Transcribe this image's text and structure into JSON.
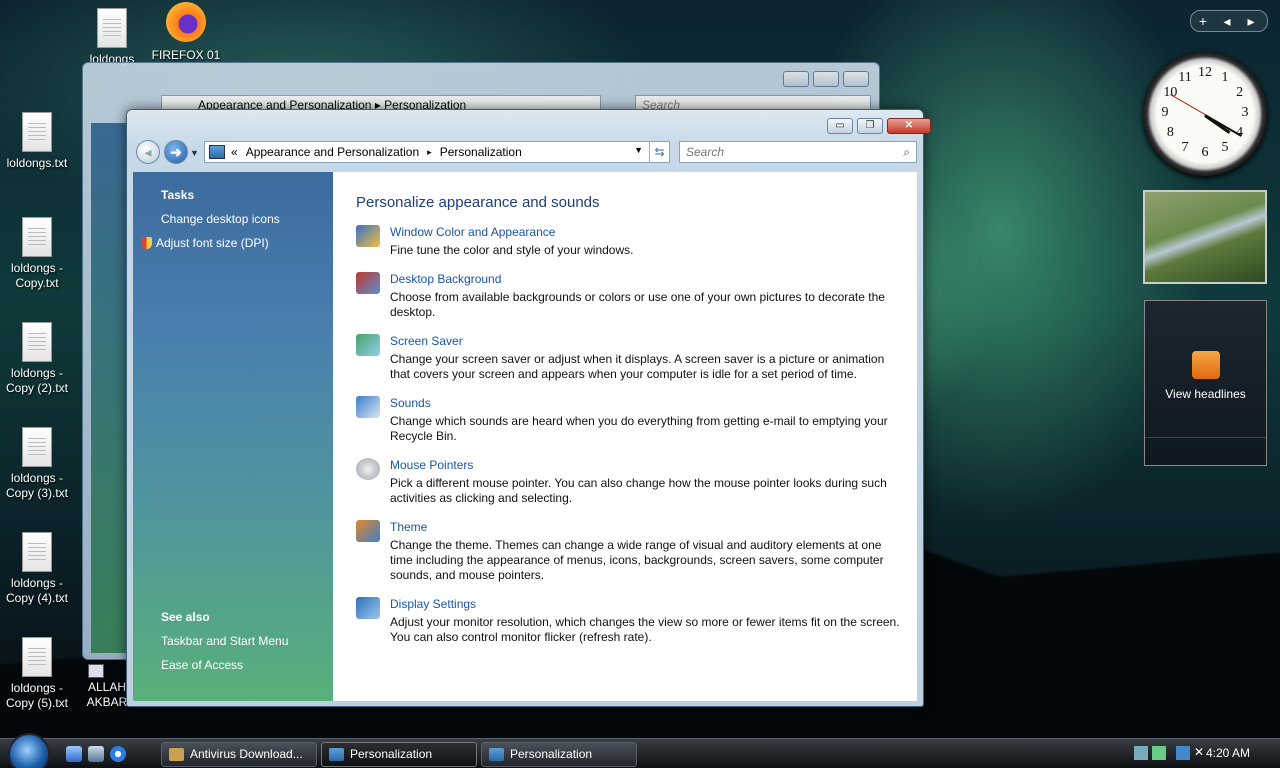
{
  "desktop": {
    "icons": [
      {
        "label": "loldongs.txt",
        "kind": "file"
      },
      {
        "label": "loldongs - Copy.txt",
        "kind": "file"
      },
      {
        "label": "loldongs - Copy (2).txt",
        "kind": "file"
      },
      {
        "label": "loldongs - Copy (3).txt",
        "kind": "file"
      },
      {
        "label": "loldongs - Copy (4).txt",
        "kind": "file"
      },
      {
        "label": "loldongs - Copy (5).txt",
        "kind": "file"
      },
      {
        "label": "loldongs",
        "kind": "file"
      },
      {
        "label": "FIREFOX 01",
        "kind": "firefox-shortcut"
      },
      {
        "label": "ALLAH AKBAR",
        "kind": "shortcut"
      }
    ]
  },
  "back_window": {
    "breadcrumb": [
      "Appearance and Personalization",
      "Personalization"
    ],
    "search_placeholder": "Search"
  },
  "window": {
    "controls": {
      "minimize": "▭",
      "maximize": "❐",
      "close": "✕"
    },
    "breadcrumb_prefix": "«",
    "breadcrumb": [
      "Appearance and Personalization",
      "Personalization"
    ],
    "breadcrumb_sep": "▸",
    "search_placeholder": "Search",
    "sidebar": {
      "tasks_heading": "Tasks",
      "tasks": [
        "Change desktop icons",
        "Adjust font size (DPI)"
      ],
      "see_also_heading": "See also",
      "see_also": [
        "Taskbar and Start Menu",
        "Ease of Access"
      ]
    },
    "main": {
      "heading": "Personalize appearance and sounds",
      "items": [
        {
          "title": "Window Color and Appearance",
          "desc": "Fine tune the color and style of your windows.",
          "icon": "window-color-icon",
          "color": "#3a6fc4"
        },
        {
          "title": "Desktop Background",
          "desc": "Choose from available backgrounds or colors or use one of your own pictures to decorate the desktop.",
          "icon": "desktop-background-icon",
          "color": "#c0392b"
        },
        {
          "title": "Screen Saver",
          "desc": "Change your screen saver or adjust when it displays. A screen saver is a picture or animation that covers your screen and appears when your computer is idle for a set period of time.",
          "icon": "screen-saver-icon",
          "color": "#4aa06a"
        },
        {
          "title": "Sounds",
          "desc": "Change which sounds are heard when you do everything from getting e-mail to emptying your Recycle Bin.",
          "icon": "sounds-icon",
          "color": "#3b7fc8"
        },
        {
          "title": "Mouse Pointers",
          "desc": "Pick a different mouse pointer. You can also change how the mouse pointer looks during such activities as clicking and selecting.",
          "icon": "mouse-pointers-icon",
          "color": "#9aa4ae"
        },
        {
          "title": "Theme",
          "desc": "Change the theme. Themes can change a wide range of visual and auditory elements at one time including the appearance of menus, icons, backgrounds, screen savers, some computer sounds, and mouse pointers.",
          "icon": "theme-icon",
          "color": "#e0892c"
        },
        {
          "title": "Display Settings",
          "desc": "Adjust your monitor resolution, which changes the view so more or fewer items fit on the screen. You can also control monitor flicker (refresh rate).",
          "icon": "display-settings-icon",
          "color": "#2f6fb8"
        }
      ]
    }
  },
  "sidebar_gadgets": {
    "toolbar": [
      "+",
      "◂",
      "▸"
    ],
    "clock_numbers": [
      "12",
      "1",
      "2",
      "3",
      "4",
      "5",
      "6",
      "7",
      "8",
      "9",
      "10",
      "11"
    ],
    "feed_label": "View headlines"
  },
  "taskbar": {
    "buttons": [
      {
        "label": "Antivirus Download...",
        "active": false
      },
      {
        "label": "Personalization",
        "active": true
      },
      {
        "label": "Personalization",
        "active": false
      }
    ],
    "time": "4:20 AM"
  }
}
